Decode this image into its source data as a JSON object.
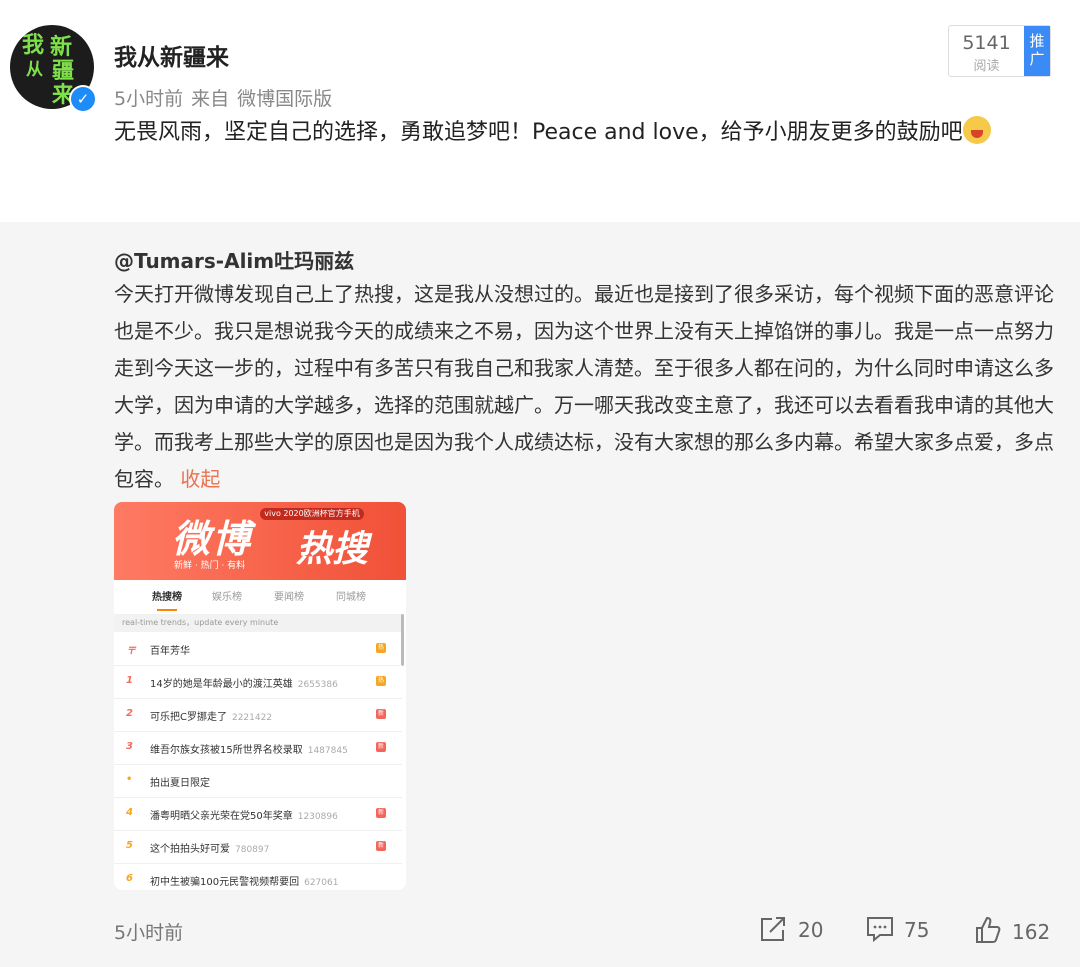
{
  "post": {
    "username": "我从新疆来",
    "avatar_text": [
      "我",
      "新",
      "从",
      "疆",
      "来"
    ],
    "time": "5小时前",
    "from": "来自",
    "client": "微博国际版",
    "text": "无畏风雨，坚定自己的选择，勇敢追梦吧！Peace and love，给予小朋友更多的鼓励吧",
    "read_count": "5141",
    "read_label": "阅读",
    "promote_label": "推广",
    "verified_mark": "✓"
  },
  "repost": {
    "source_user": "@Tumars-Alim吐玛丽兹",
    "text": "今天打开微博发现自己上了热搜，这是我从没想过的。最近也是接到了很多采访，每个视频下面的恶意评论也是不少。我只是想说我今天的成绩来之不易，因为这个世界上没有天上掉馅饼的事儿。我是一点一点努力走到今天这一步的，过程中有多苦只有我自己和我家人清楚。至于很多人都在问的，为什么同时申请这么多大学，因为申请的大学越多，选择的范围就越广。万一哪天我改变主意了，我还可以去看看我申请的其他大学。而我考上那些大学的原因也是因为我个人成绩达标，没有大家想的那么多内幕。希望大家多点爱，多点包容。",
    "collapse_label": "收起",
    "screenshot": {
      "banner_title_1": "微博",
      "banner_title_2": "热搜",
      "banner_pill": "vivo 2020欧洲杯官方手机",
      "banner_sub": "新鲜 · 热门 · 有料",
      "tabs": [
        "热搜榜",
        "娱乐榜",
        "要闻榜",
        "同城榜"
      ],
      "trend_header": "real-time trends，update every minute",
      "rows": [
        {
          "rank": "〒",
          "title": "百年芳华",
          "count": "",
          "tag": "热",
          "tag_color": "#f6a623"
        },
        {
          "rank": "1",
          "title": "14岁的她是年龄最小的渡江英雄",
          "count": "2655386",
          "tag": "热",
          "tag_color": "#f6a623"
        },
        {
          "rank": "2",
          "title": "可乐把C罗挪走了",
          "count": "2221422",
          "tag": "新",
          "tag_color": "#f2665c"
        },
        {
          "rank": "3",
          "title": "维吾尔族女孩被15所世界名校录取",
          "count": "1487845",
          "tag": "新",
          "tag_color": "#f2665c"
        },
        {
          "rank": "•",
          "title": "拍出夏日限定",
          "count": "",
          "tag": "",
          "tag_color": ""
        },
        {
          "rank": "4",
          "title": "潘粤明晒父亲光荣在党50年奖章",
          "count": "1230896",
          "tag": "新",
          "tag_color": "#f2665c"
        },
        {
          "rank": "5",
          "title": "这个拍拍头好可爱",
          "count": "780897",
          "tag": "新",
          "tag_color": "#f2665c"
        },
        {
          "rank": "6",
          "title": "初中生被骗100元民警视频帮要回",
          "count": "627061",
          "tag": "",
          "tag_color": ""
        }
      ]
    }
  },
  "footer": {
    "time": "5小时前",
    "repost_count": "20",
    "comment_count": "75",
    "like_count": "162"
  }
}
